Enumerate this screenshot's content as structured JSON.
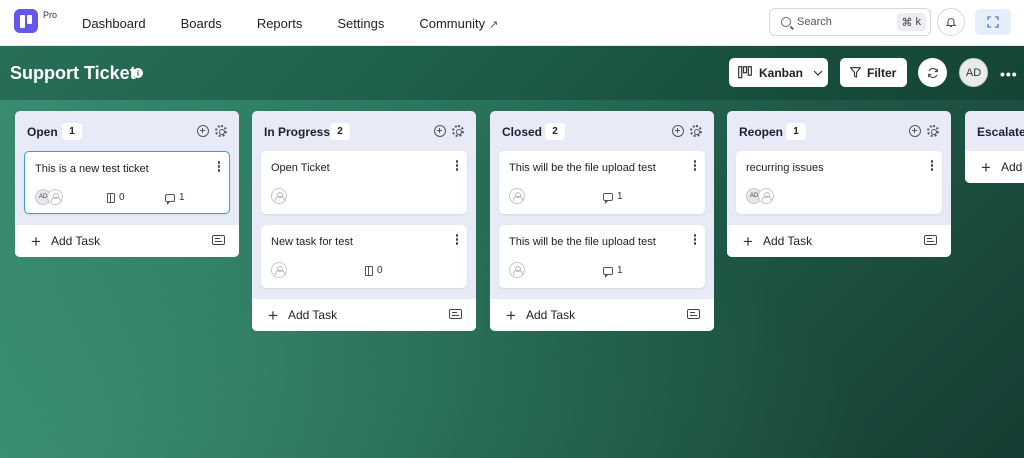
{
  "nav": {
    "badge": "Pro",
    "links": [
      "Dashboard",
      "Boards",
      "Reports",
      "Settings",
      "Community"
    ],
    "community_icon": "external-link-icon",
    "search_placeholder": "Search",
    "search_shortcut_symbol": "⌘",
    "search_shortcut_key": "k"
  },
  "board": {
    "title": "Support Ticket",
    "view_label": "Kanban",
    "filter_label": "Filter",
    "user_initials": "AD"
  },
  "columns": [
    {
      "title": "Open",
      "count": "1",
      "cards": [
        {
          "title": "This is a new test ticket",
          "assignee": "AD",
          "subtasks": "0",
          "comments": "1",
          "selected": true
        }
      ],
      "add_label": "Add Task"
    },
    {
      "title": "In Progress",
      "count": "2",
      "cards": [
        {
          "title": "Open Ticket"
        },
        {
          "title": "New task for test",
          "subtasks": "0"
        }
      ],
      "add_label": "Add Task"
    },
    {
      "title": "Closed",
      "count": "2",
      "cards": [
        {
          "title": "This will be the file upload test",
          "comments": "1"
        },
        {
          "title": "This will be the file upload test",
          "comments": "1"
        }
      ],
      "add_label": "Add Task"
    },
    {
      "title": "Reopen",
      "count": "1",
      "cards": [
        {
          "title": "recurring issues",
          "assignee": "AD"
        }
      ],
      "add_label": "Add Task"
    },
    {
      "title": "Escalated",
      "cards": [],
      "add_label": "Add"
    }
  ]
}
